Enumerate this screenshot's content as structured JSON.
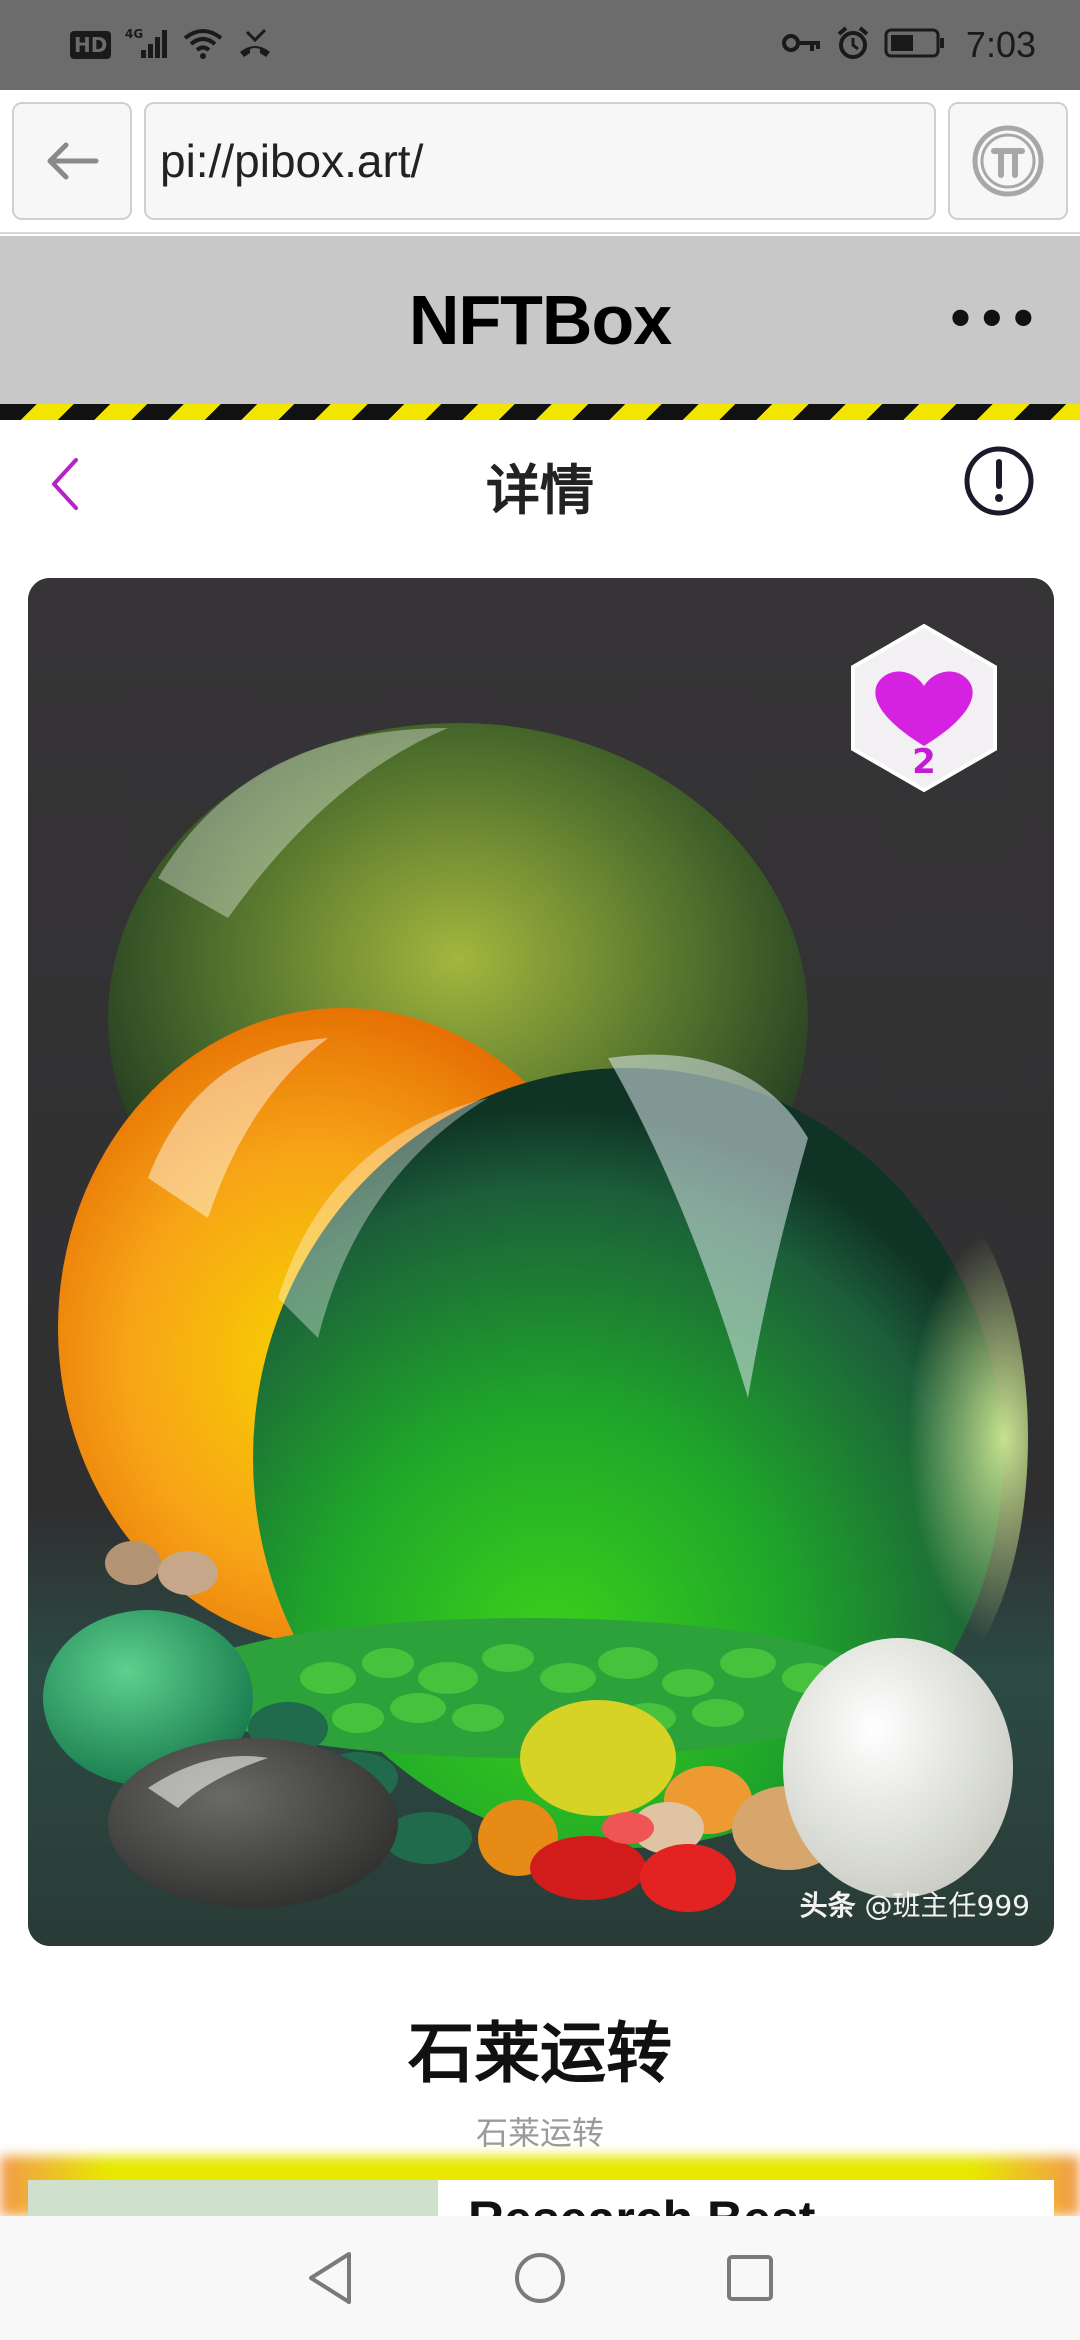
{
  "status_bar": {
    "network": "4G",
    "hd_label": "HD",
    "time": "7:03"
  },
  "browser": {
    "url": "pi://pibox.art/",
    "back_icon": "arrow-left-icon",
    "pi_icon": "pi-coin-icon"
  },
  "app_header": {
    "title": "NFTBox",
    "more": "•••"
  },
  "page_header": {
    "title": "详情",
    "back_icon": "chevron-left-icon",
    "info_icon": "exclamation-circle-icon"
  },
  "nft": {
    "like_count": "2",
    "watermark_brand": "头条",
    "watermark_user": "@班主任999",
    "title": "石莱运转",
    "subtitle": "石莱运转"
  },
  "ad": {
    "text": "Research Best"
  },
  "nav": {
    "back_icon": "triangle-back-icon",
    "home_icon": "circle-home-icon",
    "recents_icon": "square-recents-icon"
  },
  "colors": {
    "accent": "#c21cd4",
    "header_bg": "#c8c8c8",
    "hazard_yellow": "#f2e600",
    "status_bg": "#6c6c6c"
  }
}
